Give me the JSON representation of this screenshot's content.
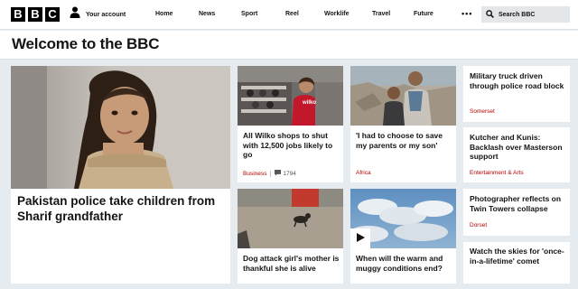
{
  "header": {
    "logo_letters": [
      "B",
      "B",
      "C"
    ],
    "account_label": "Your account",
    "nav": [
      {
        "label": "Home"
      },
      {
        "label": "News"
      },
      {
        "label": "Sport"
      },
      {
        "label": "Reel"
      },
      {
        "label": "Worklife"
      },
      {
        "label": "Travel"
      },
      {
        "label": "Future"
      }
    ],
    "more_label": "•••",
    "search_label": "Search BBC"
  },
  "page": {
    "title": "Welcome to the BBC"
  },
  "colors": {
    "tag_red": "#b80000",
    "page_bg": "#e6ebef"
  },
  "stories": {
    "lead": {
      "headline": "Pakistan police take children from Sharif grandfather"
    },
    "wilko": {
      "headline": "All Wilko shops to shut with 12,500 jobs likely to go",
      "tag": "Business",
      "comments": "1794",
      "image_sign": "wilko"
    },
    "choose": {
      "headline": "'I had to choose to save my parents or my son'",
      "tag": "Africa"
    },
    "truck": {
      "headline": "Military truck driven through police road block",
      "tag": "Somerset"
    },
    "kutcher": {
      "headline": "Kutcher and Kunis: Backlash over Masterson support",
      "tag": "Entertainment & Arts"
    },
    "dog": {
      "headline": "Dog attack girl's mother is thankful she is alive"
    },
    "weather": {
      "headline": "When will the warm and muggy conditions end?"
    },
    "photographer": {
      "headline": "Photographer reflects on Twin Towers collapse",
      "tag": "Dorset"
    },
    "comet": {
      "headline": "Watch the skies for 'once-in-a-lifetime' comet"
    }
  }
}
